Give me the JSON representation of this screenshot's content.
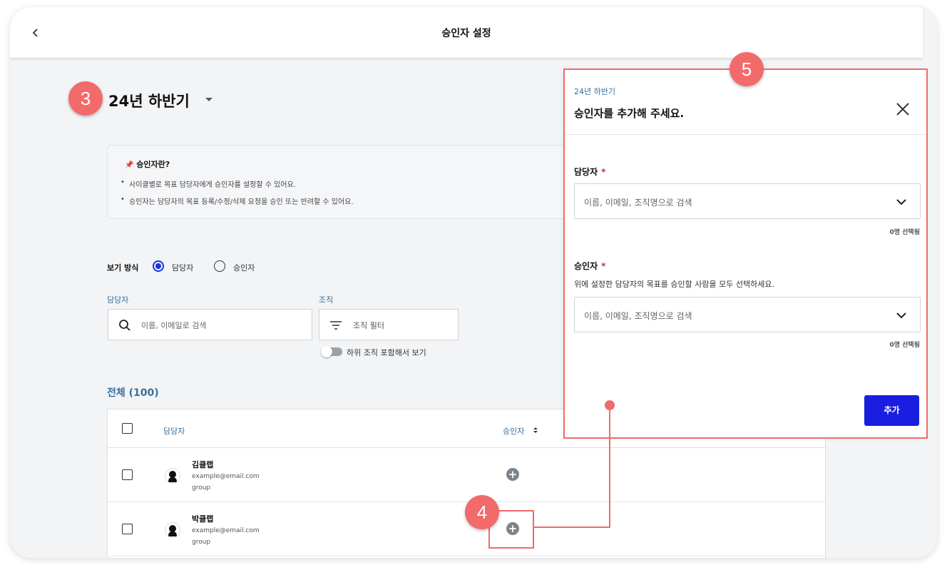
{
  "topbar": {
    "title": "승인자 설정"
  },
  "period": {
    "label": "24년 하반기"
  },
  "info": {
    "title": "승인자란?",
    "lines": [
      "사이클별로 목표 담당자에게 승인자를 설정할 수 있어요.",
      "승인자는 담당자의 목표 등록/수정/삭제 요청을 승인 또는 반려할 수 있어요."
    ]
  },
  "view_mode": {
    "label": "보기 방식",
    "options": [
      "담당자",
      "승인자"
    ],
    "selected": "담당자"
  },
  "filters": {
    "assignee_label": "담당자",
    "assignee_placeholder": "이름, 이메일로 검색",
    "org_label": "조직",
    "org_placeholder": "조직 필터",
    "include_sub_label": "하위 조직 포함해서 보기",
    "include_sub_on": false
  },
  "table": {
    "total_label": "전체 (100)",
    "headers": [
      "담당자",
      "승인자"
    ],
    "rows": [
      {
        "name": "김클랩",
        "email": "example@email.com",
        "group": "group"
      },
      {
        "name": "박클랩",
        "email": "example@email.com",
        "group": "group"
      }
    ]
  },
  "panel": {
    "subtitle": "24년 하반기",
    "title": "승인자를 추가해 주세요.",
    "assignee_label": "담당자",
    "assignee_placeholder": "이름, 이메일, 조직명으로 검색",
    "assignee_count": "0명 선택됨",
    "approver_label": "승인자",
    "approver_desc": "위에 설정한 담당자의 목표를 승인할 사람을 모두 선택하세요.",
    "approver_placeholder": "이름, 이메일, 조직명으로 검색",
    "approver_count": "0명 선택됨",
    "add_label": "추가",
    "required_mark": "*"
  },
  "annotations": {
    "badge_3": "3",
    "badge_4": "4",
    "badge_5": "5"
  },
  "colors": {
    "accent": "#1a1ee0",
    "highlight": "#f26a6a",
    "label_blue": "#3a6f9a",
    "background": "#f2f4f6"
  },
  "icons": [
    "back-icon",
    "caret-down-icon",
    "pin-icon",
    "search-icon",
    "filter-icon",
    "sort-icon",
    "avatar-icon",
    "plus-circle-icon",
    "close-icon",
    "chevron-down-icon"
  ]
}
